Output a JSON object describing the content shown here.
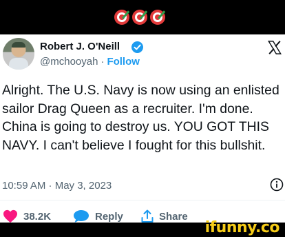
{
  "header": {
    "emoji_icons": [
      "dart-target",
      "dart-target",
      "dart-target"
    ]
  },
  "tweet": {
    "author_name": "Robert J. O'Neill",
    "handle": "@mchooyah",
    "separator": "·",
    "follow_label": "Follow",
    "text": "Alright. The U.S. Navy is now using an enlisted sailor Drag Queen as a recruiter. I'm done. China is going to destroy us. YOU GOT THIS NAVY. I can't believe I fought for this bullshit.",
    "timestamp": "10:59 AM · May 3, 2023"
  },
  "actions": {
    "like_count": "38.2K",
    "reply_label": "Reply",
    "share_label": "Share"
  },
  "watermark": {
    "text": "ifunny.co"
  },
  "colors": {
    "accent": "#1d9bf0",
    "like": "#f91880",
    "watermark": "#f6cc17",
    "text": "#0f1419",
    "muted": "#536471"
  }
}
